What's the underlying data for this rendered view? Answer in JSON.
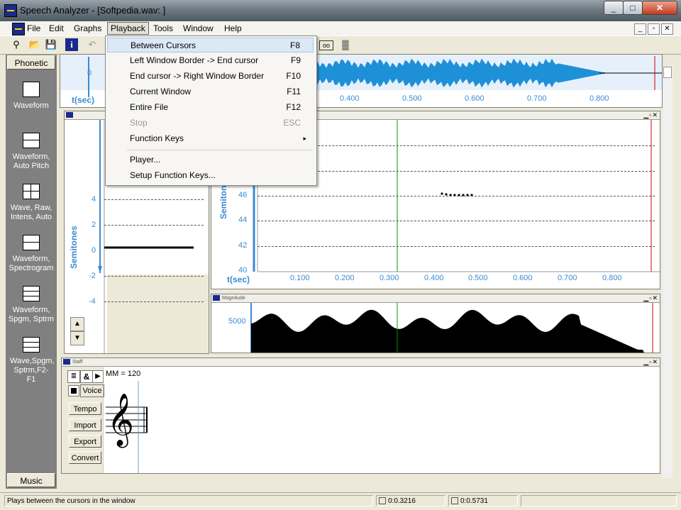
{
  "window": {
    "title": "Speech Analyzer - [Softpedia.wav: ]",
    "min": "_",
    "max": "□",
    "close": "✕"
  },
  "menubar": {
    "items": [
      "File",
      "Edit",
      "Graphs",
      "Playback",
      "Tools",
      "Window",
      "Help"
    ],
    "active": "Playback"
  },
  "playback_menu": {
    "items": [
      {
        "label": "Between Cursors",
        "key": "F8"
      },
      {
        "label": "Left Window Border -> End cursor",
        "key": "F9"
      },
      {
        "label": "End cursor -> Right Window Border",
        "key": "F10"
      },
      {
        "label": "Current Window",
        "key": "F11"
      },
      {
        "label": "Entire File",
        "key": "F12"
      },
      {
        "label": "Stop",
        "key": "ESC"
      },
      {
        "label": "Function Keys",
        "key": "▸"
      },
      {
        "label": "Player...",
        "key": ""
      },
      {
        "label": "Setup Function Keys...",
        "key": ""
      }
    ]
  },
  "left_panel": {
    "tab": "Phonetic",
    "layouts": [
      "Waveform",
      "Waveform, Auto Pitch",
      "Wave, Raw, Intens, Auto",
      "Waveform, Spectrogram",
      "Waveform, Spgm, Sptrm",
      "Wave,Spgm, Sptrm,F2-F1"
    ],
    "bottom_tab": "Music"
  },
  "waveform": {
    "y_tick": "0",
    "x_label": "t(sec)",
    "ticks": [
      "0.400",
      "0.500",
      "0.600",
      "0.700",
      "0.800"
    ]
  },
  "tonal": {
    "ylabel": "Semitones",
    "ticks": [
      "4",
      "2",
      "0",
      "-2",
      "-4"
    ]
  },
  "pitch": {
    "ylabel": "Semitones",
    "yticks": [
      "46",
      "44",
      "42",
      "40"
    ],
    "x_label": "t(sec)",
    "xticks": [
      "0.100",
      "0.200",
      "0.300",
      "0.400",
      "0.500",
      "0.600",
      "0.700",
      "0.800"
    ]
  },
  "magnitude": {
    "title": "Magnitude",
    "tick": "5000"
  },
  "staff": {
    "title": "Staff",
    "tempo_text": "MM = 120",
    "voice_label": "Voice",
    "buttons": [
      "Tempo",
      "Import",
      "Export",
      "Convert"
    ]
  },
  "status": {
    "text": "Plays between the cursors in the window",
    "pos1": "0:0.3216",
    "pos2": "0:0.5731"
  },
  "colors": {
    "accent": "#3a8ad4",
    "cursor_start": "#009900",
    "cursor_end": "#cc0000",
    "wave": "#1e90d8"
  }
}
